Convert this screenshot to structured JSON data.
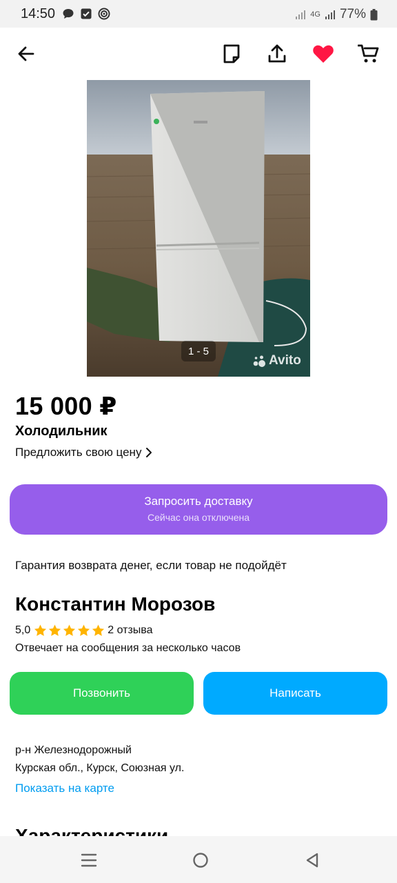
{
  "status_bar": {
    "time": "14:50",
    "network": "4G",
    "battery": "77%",
    "icons": [
      "chat-bubble-icon",
      "checkbox-icon",
      "target-icon",
      "signal-icon",
      "signal-icon",
      "battery-icon"
    ]
  },
  "top_bar": {
    "icons": [
      "back-arrow-icon",
      "note-icon",
      "share-icon",
      "heart-icon",
      "cart-icon"
    ],
    "favorite_color": "#ff1744"
  },
  "gallery": {
    "counter": "1 - 5",
    "watermark": "Avito"
  },
  "listing": {
    "price": "15 000 ₽",
    "title": "Холодильник",
    "offer_link": "Предложить свою цену"
  },
  "delivery": {
    "label": "Запросить доставку",
    "sublabel": "Сейчас она отключена",
    "color": "#965eeb"
  },
  "guarantee": "Гарантия возврата денег, если товар не подойдёт",
  "seller": {
    "name": "Константин Морозов",
    "rating": "5,0",
    "stars": 5,
    "reviews": "2 отзыва",
    "reply_time": "Отвечает на сообщения за несколько часов",
    "star_color": "#ffb400"
  },
  "actions": {
    "call": "Позвонить",
    "call_color": "#2fd158",
    "message": "Написать",
    "message_color": "#00aaff"
  },
  "location": {
    "district": "р-н Железнодорожный",
    "address": "Курская обл., Курск, Союзная ул.",
    "map_link": "Показать на карте"
  },
  "section": {
    "title": "Характеристики"
  },
  "nav_bar": {
    "icons": [
      "recent-apps-icon",
      "home-icon",
      "back-icon"
    ]
  }
}
